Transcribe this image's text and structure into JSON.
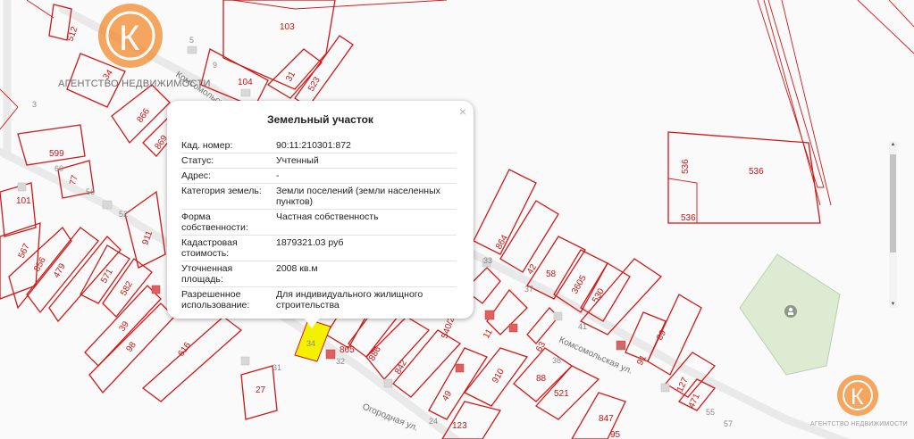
{
  "watermark": {
    "top_text": "АГЕНТСТВО НЕДВИЖИМОСТИ",
    "bottom_text": "АГЕНТСТВО НЕДВИЖИМОСТИ",
    "logo_color": "#f28a2c"
  },
  "popup": {
    "title": "Земельный участок",
    "close_symbol": "×",
    "rows": [
      {
        "key": "Кад. номер:",
        "value": "90:11:210301:872"
      },
      {
        "key": "Статус:",
        "value": "Учтенный"
      },
      {
        "key": "Адрес:",
        "value": "-"
      },
      {
        "key": "Категория земель:",
        "value": "Земли поселений (земли населенных пунктов)"
      },
      {
        "key": "Форма собственности:",
        "value": "Частная собственность"
      },
      {
        "key": "Кадастровая стоимость:",
        "value": "1879321.03 руб"
      },
      {
        "key": "Уточненная площадь:",
        "value": "2008 кв.м"
      },
      {
        "key": "Разрешенное использование:",
        "value": "Для индивидуального жилищного строительства"
      }
    ]
  },
  "map": {
    "streets": [
      "Комсомольская ул.",
      "Комсомольская ул.",
      "Огородная ул."
    ],
    "plot_labels": [
      "103",
      "104",
      "31",
      "523",
      "512",
      "34",
      "866",
      "869",
      "599",
      "77",
      "101",
      "567",
      "856",
      "479",
      "571",
      "582",
      "911",
      "39",
      "98",
      "616",
      "27",
      "865",
      "34",
      "886",
      "842",
      "864",
      "42",
      "58",
      "3605",
      "530",
      "11",
      "540/2",
      "49",
      "910",
      "88",
      "521",
      "63",
      "91",
      "89",
      "127",
      "471",
      "123",
      "847",
      "95",
      "536",
      "536",
      "536"
    ],
    "house_numbers": [
      "5",
      "9",
      "60",
      "56",
      "52",
      "33",
      "32",
      "37",
      "38",
      "41",
      "24",
      "55",
      "57",
      "31",
      "15",
      "3"
    ],
    "highlight_color": "#f5f000",
    "boundary_color": "#d01919",
    "park_color": "#dcebd2"
  }
}
